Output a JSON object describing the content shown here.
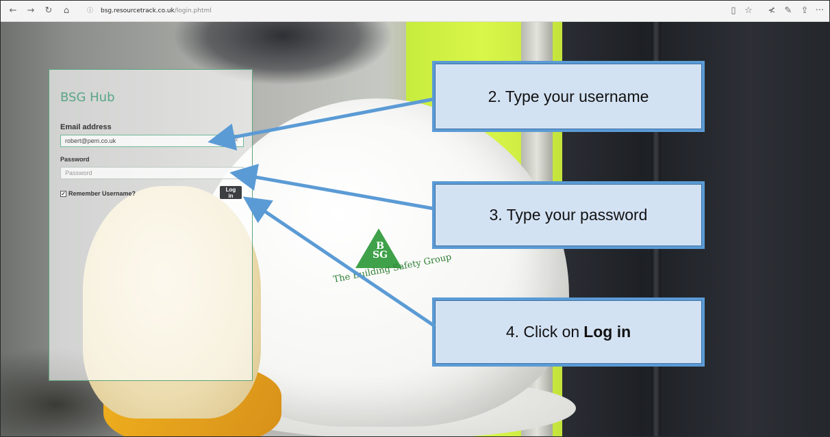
{
  "browser": {
    "nav_icons": {
      "back": "←",
      "forward": "→",
      "refresh": "↻",
      "home": "⌂"
    },
    "info_icon": "ⓘ",
    "url_host": "bsg.resourcetrack.co.uk",
    "url_path": "/login.phtml",
    "toolbar_icons": {
      "reading_view": "▯",
      "favorite": "☆",
      "favorites_hub": "≮",
      "notes": "✎",
      "share": "⇪",
      "more": "···"
    }
  },
  "login": {
    "title": "BSG Hub",
    "email_label": "Email address",
    "email_value": "robert@pem.co.uk",
    "clear_icon": "×",
    "password_label": "Password",
    "password_placeholder": "Password",
    "checkbox_mark": "✓",
    "remember_label": "Remember Username?",
    "login_button": "Log in"
  },
  "background": {
    "logo_letters_top": "B",
    "logo_letters_bottom": "SG",
    "logo_text": "The Building Safety Group",
    "colors": {
      "brand_green": "#3fa14a",
      "vest_yellow": "#d9f64a",
      "jacket_dark": "#1d2025"
    }
  },
  "callouts": {
    "step2": "2. Type your username",
    "step3": "3. Type your password",
    "step4_prefix": "4. Click on",
    "step4_bold": "Log in",
    "arrow_color": "#5b9bd5",
    "box_color": "#d3e2f3"
  }
}
